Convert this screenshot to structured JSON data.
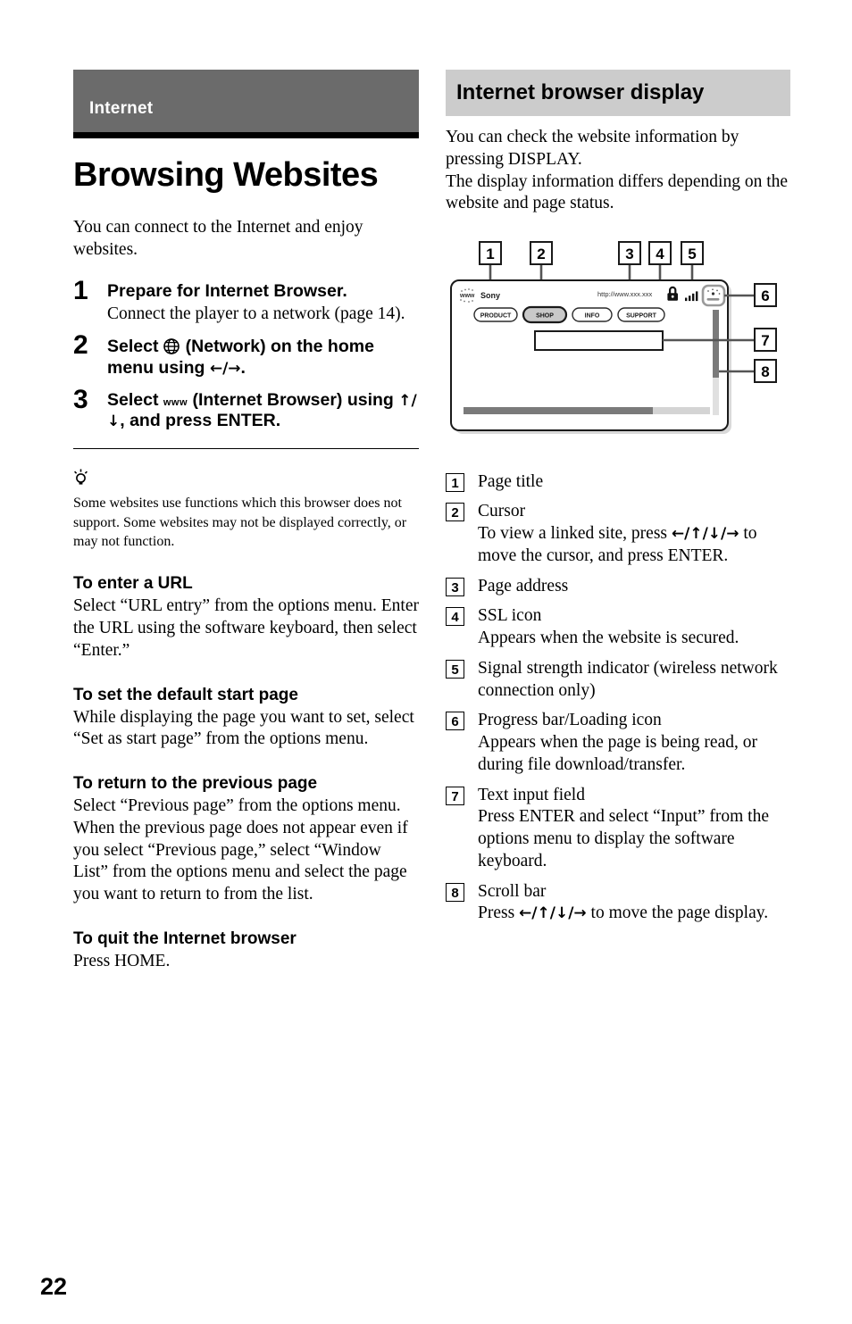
{
  "page_number": "22",
  "left": {
    "section_banner": "Internet",
    "title": "Browsing Websites",
    "intro": "You can connect to the Internet and enjoy websites.",
    "steps": [
      {
        "num": "1",
        "head": "Prepare for Internet Browser.",
        "body": "Connect the player to a network (page 14)."
      },
      {
        "num": "2",
        "head_pre": "Select",
        "icon": "globe-icon",
        "icon_glyph": "⊕",
        "head_post": "(Network) on the home menu using",
        "arrows": "←/→",
        "head_end": "."
      },
      {
        "num": "3",
        "head_pre": "Select",
        "icon": "www-icon",
        "icon_glyph": "www",
        "head_post": "(Internet Browser) using",
        "arrows": "↑/↓",
        "head_end": ", and press ENTER."
      }
    ],
    "tip": {
      "icon": "tip-bulb-icon",
      "text": "Some websites use functions which this browser does not support. Some websites may not be displayed correctly, or may not function."
    },
    "sections": [
      {
        "head": "To enter a URL",
        "body": "Select “URL entry” from the options menu. Enter the URL using the software keyboard, then select “Enter.”"
      },
      {
        "head": "To set the default start page",
        "body": "While displaying the page you want to set, select “Set as start page” from the options menu."
      },
      {
        "head": "To return to the previous page",
        "body": "Select “Previous page” from the options menu.\nWhen the previous page does not appear even if you select “Previous page,” select “Window List” from the options menu and select the page you want to return to from the list."
      },
      {
        "head": "To quit the Internet browser",
        "body": "Press HOME."
      }
    ]
  },
  "right": {
    "banner": "Internet browser display",
    "intro": "You can check the website information by pressing DISPLAY.\nThe display information differs depending on the website and page status.",
    "diagram": {
      "callouts": [
        "1",
        "2",
        "3",
        "4",
        "5",
        "6",
        "7",
        "8"
      ],
      "site_icon": "www",
      "page_title": "Sony",
      "page_address": "http://www.xxx.xxx",
      "nav_buttons": [
        "PRODUCT",
        "SHOP",
        "INFO",
        "SUPPORT"
      ],
      "selected_nav": "SHOP",
      "ssl_icon": "lock-icon",
      "signal_icon": "signal-bars-icon",
      "loading_icon": "loading-icon"
    },
    "legend": [
      {
        "num": "1",
        "title": "Page title",
        "desc": ""
      },
      {
        "num": "2",
        "title": "Cursor",
        "desc_pre": "To view a linked site, press",
        "arrows": "←/↑/↓/→",
        "desc_post": "to move the cursor, and press ENTER."
      },
      {
        "num": "3",
        "title": "Page address",
        "desc": ""
      },
      {
        "num": "4",
        "title": "SSL icon",
        "desc": "Appears when the website is secured."
      },
      {
        "num": "5",
        "title": "Signal strength indicator (wireless network connection only)",
        "desc": ""
      },
      {
        "num": "6",
        "title": "Progress bar/Loading icon",
        "desc": "Appears when the page is being read, or during file download/transfer."
      },
      {
        "num": "7",
        "title": "Text input field",
        "desc": "Press ENTER and select “Input” from the options menu to display the software keyboard."
      },
      {
        "num": "8",
        "title": "Scroll bar",
        "desc_pre": "Press",
        "arrows": "←/↑/↓/→",
        "desc_post": "to move the page display."
      }
    ]
  }
}
